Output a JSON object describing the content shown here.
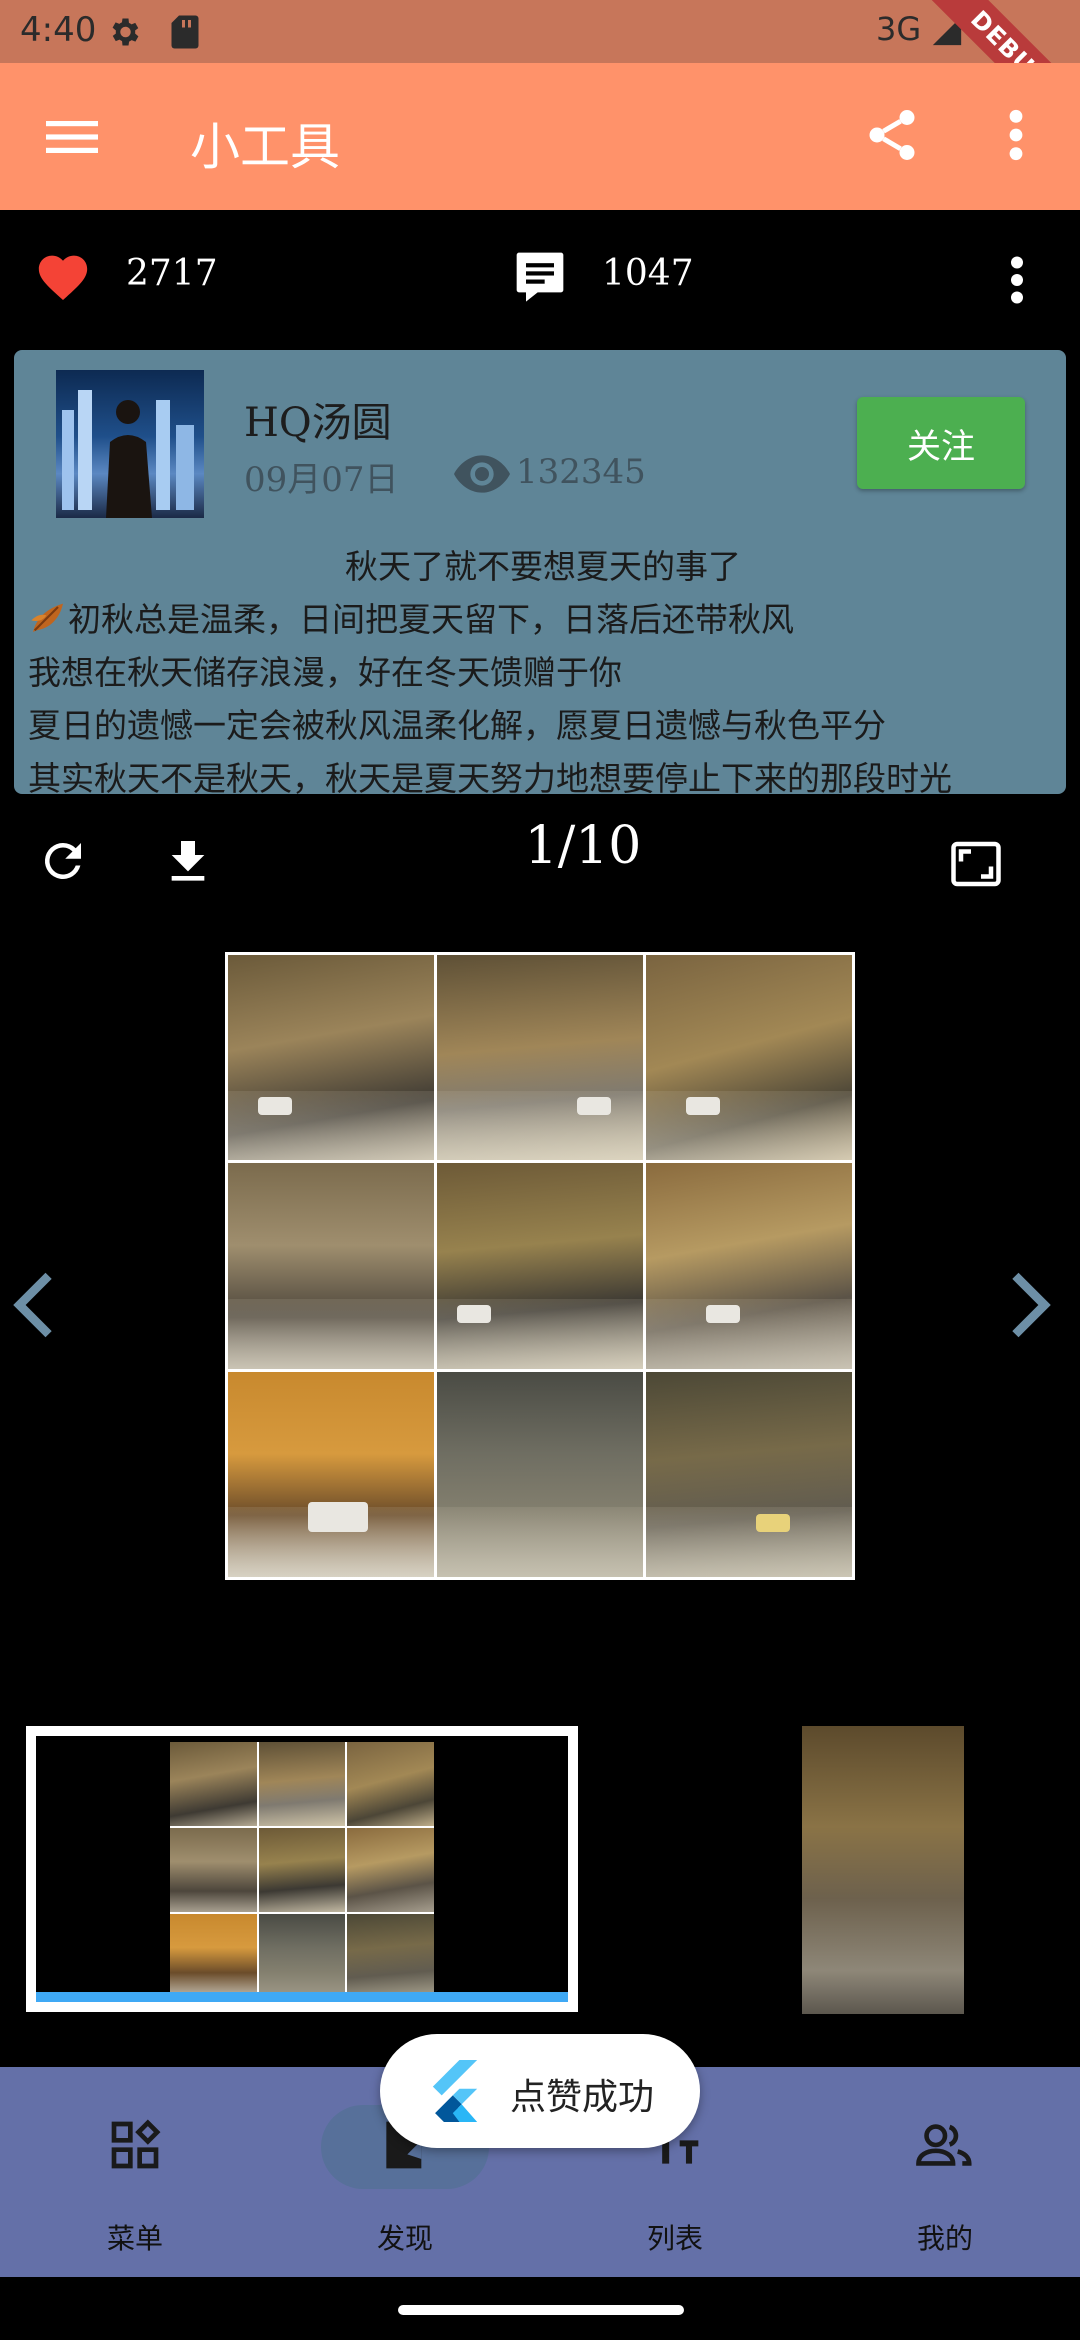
{
  "status_bar": {
    "time": "4:40",
    "network": "3G",
    "debug_banner": "DEBUG"
  },
  "app_bar": {
    "title": "小工具",
    "menu_icon": "menu-icon",
    "share_icon": "share-icon",
    "more_icon": "more-vert-icon"
  },
  "stats": {
    "likes": "2717",
    "comments": "1047"
  },
  "post": {
    "author": "HQ汤圆",
    "date": "09月07日",
    "views": "132345",
    "follow_label": "关注",
    "poem": [
      "秋天了就不要想夏天的事了",
      "初秋总是温柔，日间把夏天留下，日落后还带秋风",
      "我想在秋天储存浪漫，好在冬天馈赠于你",
      "夏日的遗憾一定会被秋风温柔化解，愿夏日遗憾与秋色平分",
      "其实秋天不是秋天，秋天是夏天努力地想要停止下来的那段时光"
    ]
  },
  "viewer": {
    "page_indicator": "1/10"
  },
  "bottom_nav": {
    "items": [
      {
        "label": "菜单",
        "icon": "widgets-icon"
      },
      {
        "label": "发现",
        "icon": "discover-icon"
      },
      {
        "label": "列表",
        "icon": "text-fields-icon"
      },
      {
        "label": "我的",
        "icon": "people-icon"
      }
    ]
  },
  "toast": {
    "message": "点赞成功"
  },
  "colors": {
    "app_bar": "#ff926a",
    "status_bar": "#c7765a",
    "card": "#5f8597",
    "follow_button": "#4caf50",
    "bottom_nav": "#6470a8",
    "like": "#f44336",
    "thumb_selected_bar": "#3fa9f5"
  }
}
